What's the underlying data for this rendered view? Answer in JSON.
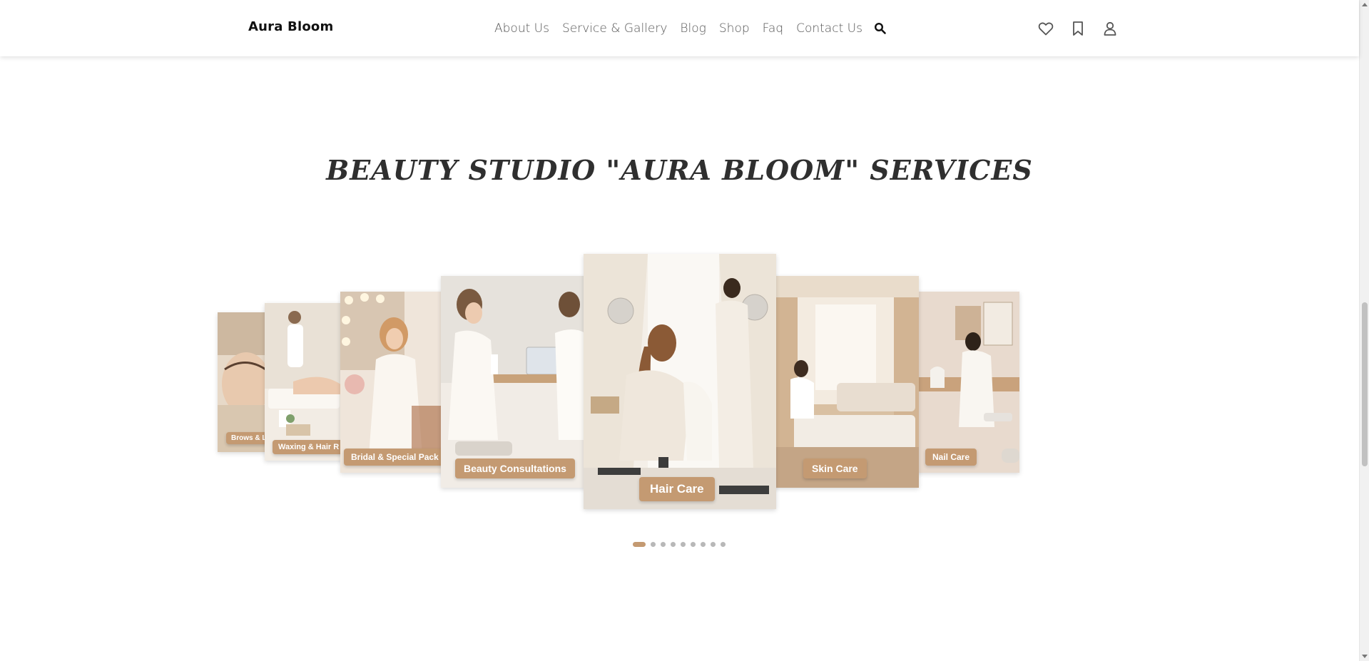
{
  "header": {
    "logo": "Aura Bloom",
    "nav": [
      {
        "label": "About Us"
      },
      {
        "label": "Service & Gallery"
      },
      {
        "label": "Blog"
      },
      {
        "label": "Shop"
      },
      {
        "label": "Faq"
      },
      {
        "label": "Contact Us"
      }
    ],
    "icons": [
      "search-icon",
      "heart-icon",
      "bookmark-icon",
      "user-icon"
    ]
  },
  "section": {
    "title": "BEAUTY STUDIO \"AURA BLOOM\" SERVICES"
  },
  "carousel": {
    "cards": [
      {
        "label": "Brows & L"
      },
      {
        "label": "Waxing & Hair R"
      },
      {
        "label": "Bridal & Special Pack"
      },
      {
        "label": "Beauty Consultations"
      },
      {
        "label": "Hair Care"
      },
      {
        "label": "Skin Care"
      },
      {
        "label": "Nail Care"
      }
    ],
    "dot_count": 9,
    "active_dot": 0
  },
  "colors": {
    "accent": "#c49a72",
    "title": "#2f2f2f"
  }
}
